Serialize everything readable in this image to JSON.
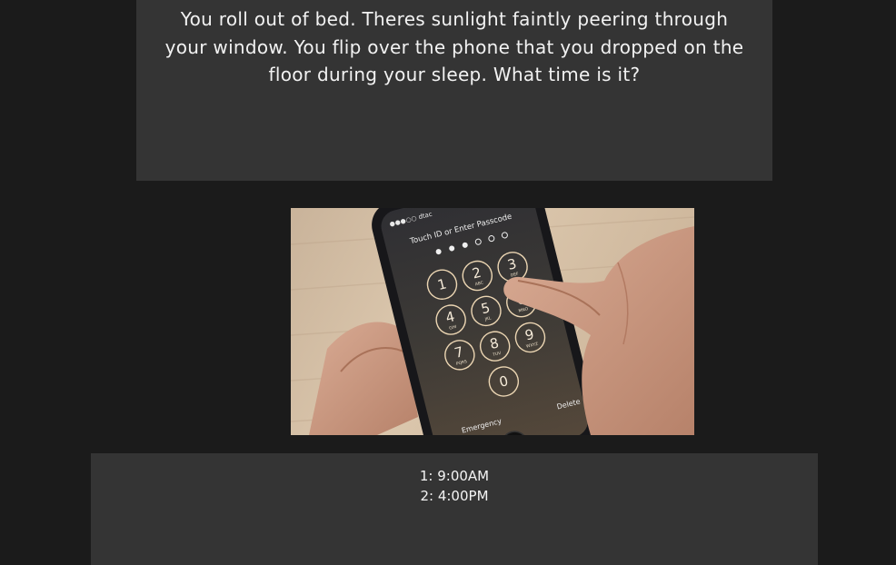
{
  "story": {
    "text": "You roll out of bed. Theres sunlight faintly peering through your window. You flip over the phone that you dropped on the floor during your sleep. What time is it?"
  },
  "phone_screen": {
    "carrier": "●●●○○ dtac",
    "prompt": "Touch ID or Enter Passcode",
    "keys": [
      {
        "digit": "1",
        "letters": ""
      },
      {
        "digit": "2",
        "letters": "ABC"
      },
      {
        "digit": "3",
        "letters": "DEF"
      },
      {
        "digit": "4",
        "letters": "GHI"
      },
      {
        "digit": "5",
        "letters": "JKL"
      },
      {
        "digit": "6",
        "letters": "MNO"
      },
      {
        "digit": "7",
        "letters": "PQRS"
      },
      {
        "digit": "8",
        "letters": "TUV"
      },
      {
        "digit": "9",
        "letters": "WXYZ"
      },
      {
        "digit": "0",
        "letters": ""
      }
    ],
    "emergency": "Emergency",
    "delete": "Delete"
  },
  "choices": [
    {
      "label": "1: 9:00AM"
    },
    {
      "label": "2: 4:00PM"
    }
  ]
}
